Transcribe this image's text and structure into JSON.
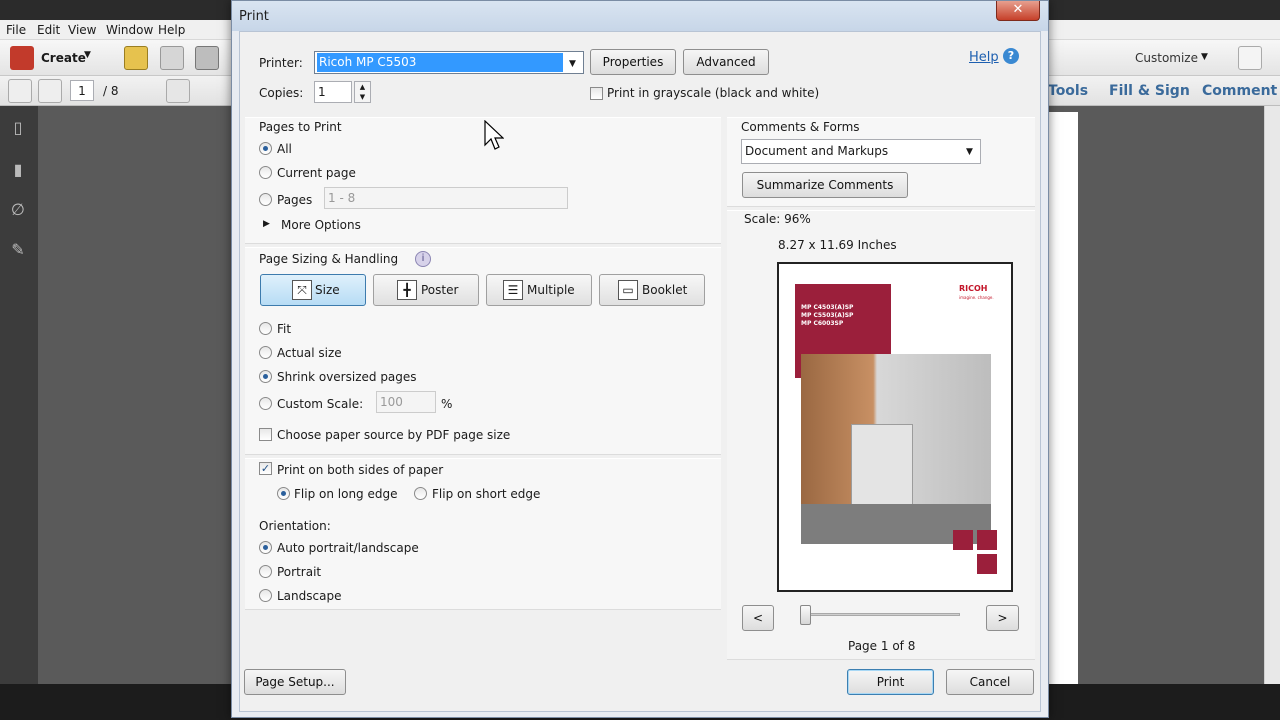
{
  "background_app": {
    "menu": [
      "File",
      "Edit",
      "View",
      "Window",
      "Help"
    ],
    "create_label": "Create",
    "page_current": "1",
    "page_total": "/ 8",
    "customize_label": "Customize",
    "right_tabs": [
      "Tools",
      "Fill & Sign",
      "Comment"
    ]
  },
  "dialog": {
    "title": "Print",
    "close_glyph": "✕",
    "help_label": "Help",
    "printer_label": "Printer:",
    "printer_value": "Ricoh MP C5503",
    "properties_label": "Properties",
    "advanced_label": "Advanced",
    "copies_label": "Copies:",
    "copies_value": "1",
    "grayscale_label": "Print in grayscale (black and white)",
    "pages_to_print": {
      "heading": "Pages to Print",
      "all": "All",
      "current": "Current page",
      "pages": "Pages",
      "pages_placeholder": "1 - 8",
      "more": "More Options",
      "selected": "all"
    },
    "sizing": {
      "heading": "Page Sizing & Handling",
      "buttons": [
        "Size",
        "Poster",
        "Multiple",
        "Booklet"
      ],
      "selected_button": "Size",
      "fit": "Fit",
      "actual": "Actual size",
      "shrink": "Shrink oversized pages",
      "custom": "Custom Scale:",
      "custom_value": "100",
      "percent": "%",
      "paper_source": "Choose paper source by PDF page size",
      "selected_option": "shrink"
    },
    "duplex": {
      "both_sides": "Print on both sides of paper",
      "both_checked": true,
      "long_edge": "Flip on long edge",
      "short_edge": "Flip on short edge",
      "selected": "long"
    },
    "orientation": {
      "heading": "Orientation:",
      "auto": "Auto portrait/landscape",
      "portrait": "Portrait",
      "landscape": "Landscape",
      "selected": "auto"
    },
    "comments_forms": {
      "heading": "Comments & Forms",
      "value": "Document and Markups",
      "summarize": "Summarize Comments"
    },
    "preview": {
      "scale": "Scale:  96%",
      "size": "8.27 x 11.69 Inches",
      "page_label": "Page 1 of 8",
      "prev": "<",
      "next": ">",
      "brand": "RICOH",
      "brand_tagline": "imagine. change.",
      "model_lines": [
        "MP C4503(A)SP",
        "MP C5503(A)SP",
        "MP C6003SP"
      ]
    },
    "page_setup_label": "Page Setup...",
    "print_label": "Print",
    "cancel_label": "Cancel"
  }
}
